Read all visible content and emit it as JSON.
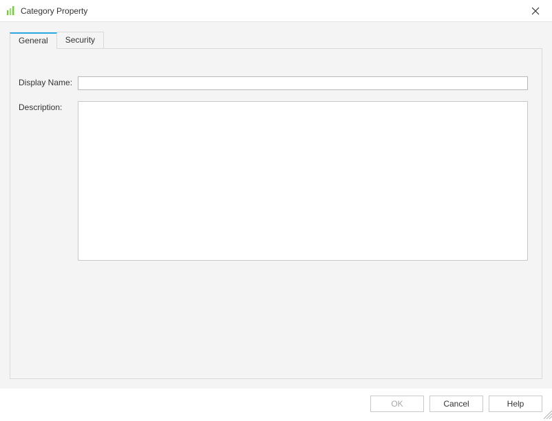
{
  "window": {
    "title": "Category Property"
  },
  "tabs": {
    "general": "General",
    "security": "Security"
  },
  "form": {
    "display_name_label": "Display Name:",
    "display_name_value": "",
    "description_label": "Description:",
    "description_value": ""
  },
  "buttons": {
    "ok": "OK",
    "cancel": "Cancel",
    "help": "Help"
  }
}
